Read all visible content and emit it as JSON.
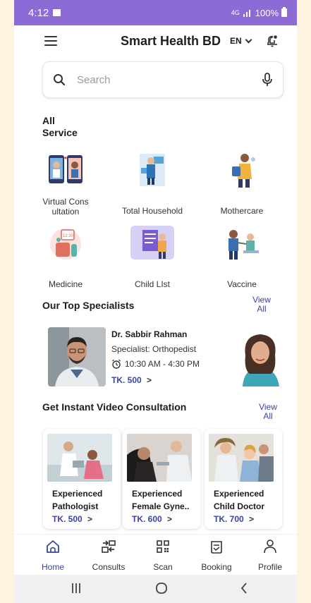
{
  "status_bar": {
    "time": "4:12",
    "network": "4G",
    "battery": "100%"
  },
  "header": {
    "title": "Smart Health BD",
    "language": "EN"
  },
  "search": {
    "placeholder": "Search"
  },
  "all_service": {
    "title_line1": "All",
    "title_line2": "Service",
    "items": [
      {
        "label_line1": "Virtual Cons",
        "label_line2": "ultation",
        "icon": "video-call-icon"
      },
      {
        "label_line1": "Total Household",
        "label_line2": "",
        "icon": "household-icon"
      },
      {
        "label_line1": "Mothercare",
        "label_line2": "",
        "icon": "mother-icon"
      },
      {
        "label_line1": "Medicine",
        "label_line2": "",
        "icon": "medicine-icon"
      },
      {
        "label_line1": "Child LIst",
        "label_line2": "",
        "icon": "child-list-icon"
      },
      {
        "label_line1": "Vaccine",
        "label_line2": "",
        "icon": "vaccine-icon"
      }
    ]
  },
  "top_specialists": {
    "title": "Our Top Specialists",
    "view_all_line1": "View",
    "view_all_line2": "All",
    "doctor": {
      "name": "Dr. Sabbir Rahman",
      "specialty": "Specialist: Orthopedist",
      "hours": "10:30 AM - 4:30 PM",
      "price": "TK. 500"
    }
  },
  "video_consultation": {
    "title": "Get Instant Video Consultation",
    "view_all_line1": "View",
    "view_all_line2": "All",
    "cards": [
      {
        "line1": "Experienced",
        "line2": "Pathologist",
        "price": "TK. 500"
      },
      {
        "line1": "Experienced",
        "line2": "Female Gyne..",
        "price": "TK. 600"
      },
      {
        "line1": "Experienced",
        "line2": "Child Doctor",
        "price": "TK. 700"
      }
    ]
  },
  "bottom_nav": {
    "items": [
      {
        "label": "Home",
        "active": true
      },
      {
        "label": "Consults",
        "active": false
      },
      {
        "label": "Scan",
        "active": false
      },
      {
        "label": "Booking",
        "active": false
      },
      {
        "label": "Profile",
        "active": false
      }
    ]
  },
  "colors": {
    "status_bar": "#8d6bd6",
    "accent": "#3a43a8",
    "page_background": "#fdf3df"
  }
}
